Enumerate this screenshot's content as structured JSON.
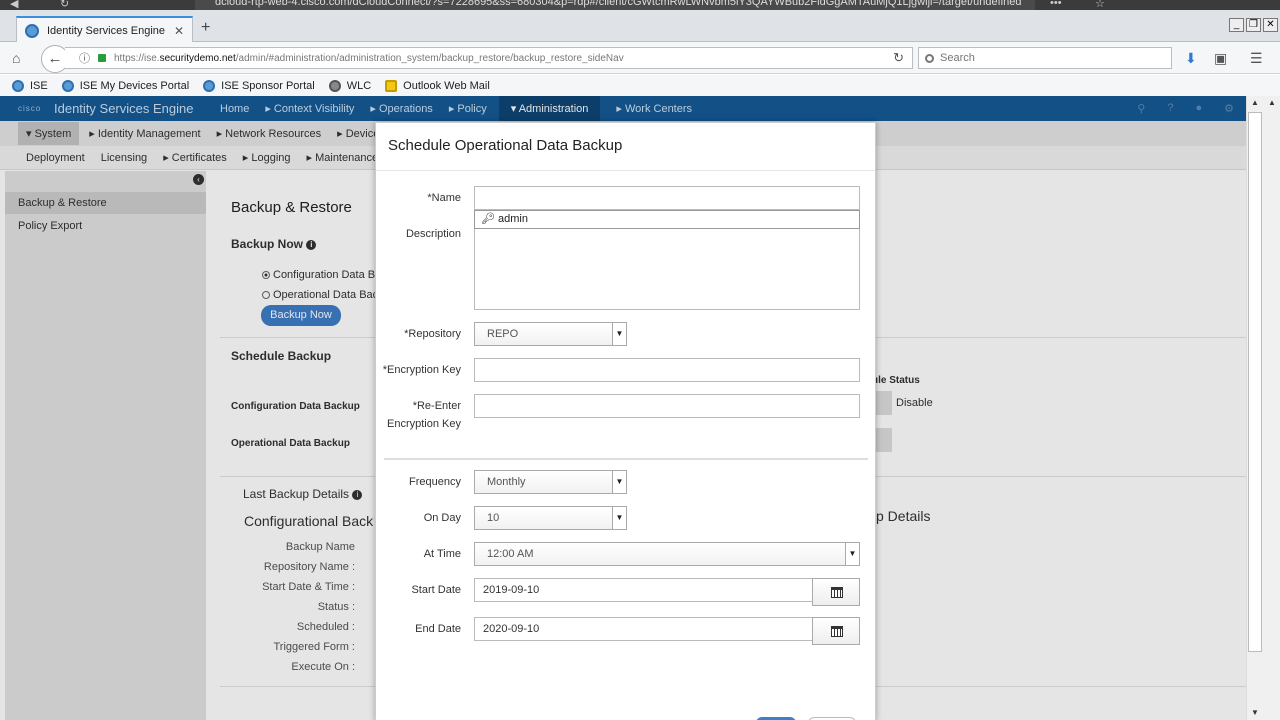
{
  "browser": {
    "remote_url": "dcloud-rtp-web-4.cisco.com/dCloudConnect/?s=7228695&ss=680304&p=rdp#/client/cGWtcmRwLWNvbm5lY3QAYWBub2FidGgAMTAuMjQ1Ljgwljl=/target/undefined",
    "tab_title": "Identity Services Engine",
    "new_tab": "+",
    "url_prefix": "https://ise.",
    "url_domain": "securitydemo.net",
    "url_rest": "/admin/#administration/administration_system/backup_restore/backup_restore_sideNav",
    "search_placeholder": "Search",
    "bookmarks": [
      "ISE",
      "ISE My Devices Portal",
      "ISE Sponsor Portal",
      "WLC",
      "Outlook Web Mail"
    ]
  },
  "header": {
    "logo_text": "cisco",
    "app_title": "Identity Services Engine",
    "nav": [
      "Home",
      "▸ Context Visibility",
      "▸ Operations",
      "▸ Policy",
      "▾ Administration",
      "▸ Work Centers"
    ]
  },
  "subnav1": [
    "▾ System",
    "▸ Identity Management",
    "▸ Network Resources",
    "▸ Device P"
  ],
  "subnav2": [
    "Deployment",
    "Licensing",
    "▸ Certificates",
    "▸ Logging",
    "▸ Maintenance"
  ],
  "leftnav": [
    "Backup & Restore",
    "Policy Export"
  ],
  "background": {
    "title": "Backup & Restore",
    "backup_now": "Backup Now",
    "radio_config": "Configuration Data Ba",
    "radio_operational": "Operational Data Back",
    "backup_now_button": "Backup Now",
    "schedule_backup": "Schedule Backup",
    "schedule_status_frag": "ule Status",
    "disable": "Disable",
    "config_data_backup": "Configuration Data Backup",
    "operational_data_backup": "Operational Data Backup",
    "last_backup_details": "Last Backup Details",
    "configurational_back": "Configurational Back",
    "p_details": "p Details",
    "detail_labels": [
      "Backup Name",
      "Repository Name :",
      "Start Date & Time :",
      "Status :",
      "Scheduled :",
      "Triggered Form :",
      "Execute On :"
    ]
  },
  "modal": {
    "title": "Schedule Operational Data Backup",
    "name_label": "*Name",
    "name_value": "",
    "autofill_value": "admin",
    "description_label": "Description",
    "repository_label": "*Repository",
    "repository_value": "REPO",
    "encryption_label": "*Encryption Key",
    "reenter_label_1": "*Re-Enter",
    "reenter_label_2": "Encryption Key",
    "frequency_label": "Frequency",
    "frequency_value": "Monthly",
    "on_day_label": "On Day",
    "on_day_value": "10",
    "at_time_label": "At Time",
    "at_time_value": "12:00 AM",
    "start_date_label": "Start Date",
    "start_date_value": "2019-09-10",
    "end_date_label": "End Date",
    "end_date_value": "2020-09-10"
  }
}
